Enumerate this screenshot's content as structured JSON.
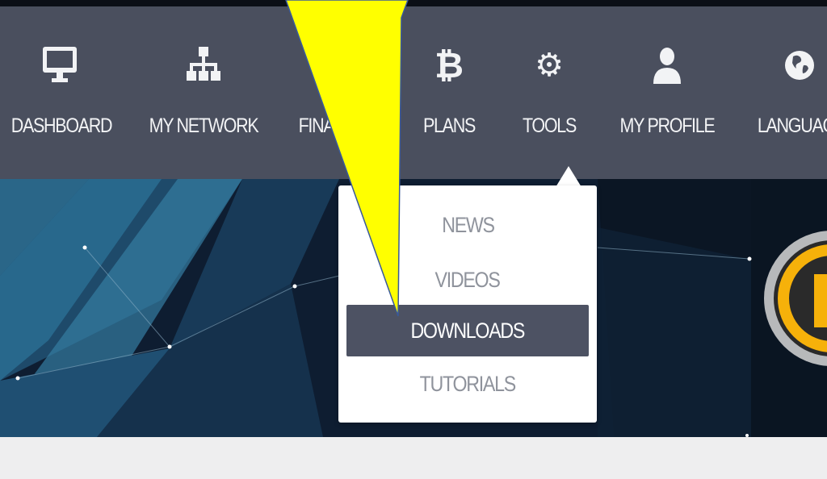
{
  "nav": {
    "items": [
      {
        "label": "DASHBOARD",
        "icon": "monitor-icon"
      },
      {
        "label": "MY NETWORK",
        "icon": "network-icon"
      },
      {
        "label": "FINA",
        "icon": "finance-icon"
      },
      {
        "label": "PLANS",
        "icon": "bitcoin-icon"
      },
      {
        "label": "TOOLS",
        "icon": "gear-icon"
      },
      {
        "label": "MY PROFILE",
        "icon": "user-icon"
      },
      {
        "label": "LANGUAG",
        "icon": "globe-icon"
      }
    ]
  },
  "tools_menu": {
    "items": [
      {
        "label": "NEWS",
        "active": false
      },
      {
        "label": "VIDEOS",
        "active": false
      },
      {
        "label": "DOWNLOADS",
        "active": true
      },
      {
        "label": "TUTORIALS",
        "active": false
      }
    ]
  },
  "colors": {
    "navbar": "#4a4f5e",
    "active_item": "#4d5263",
    "arrow": "#ffff00",
    "hero": "#0e1d31",
    "logo_accent": "#f6b10a"
  }
}
